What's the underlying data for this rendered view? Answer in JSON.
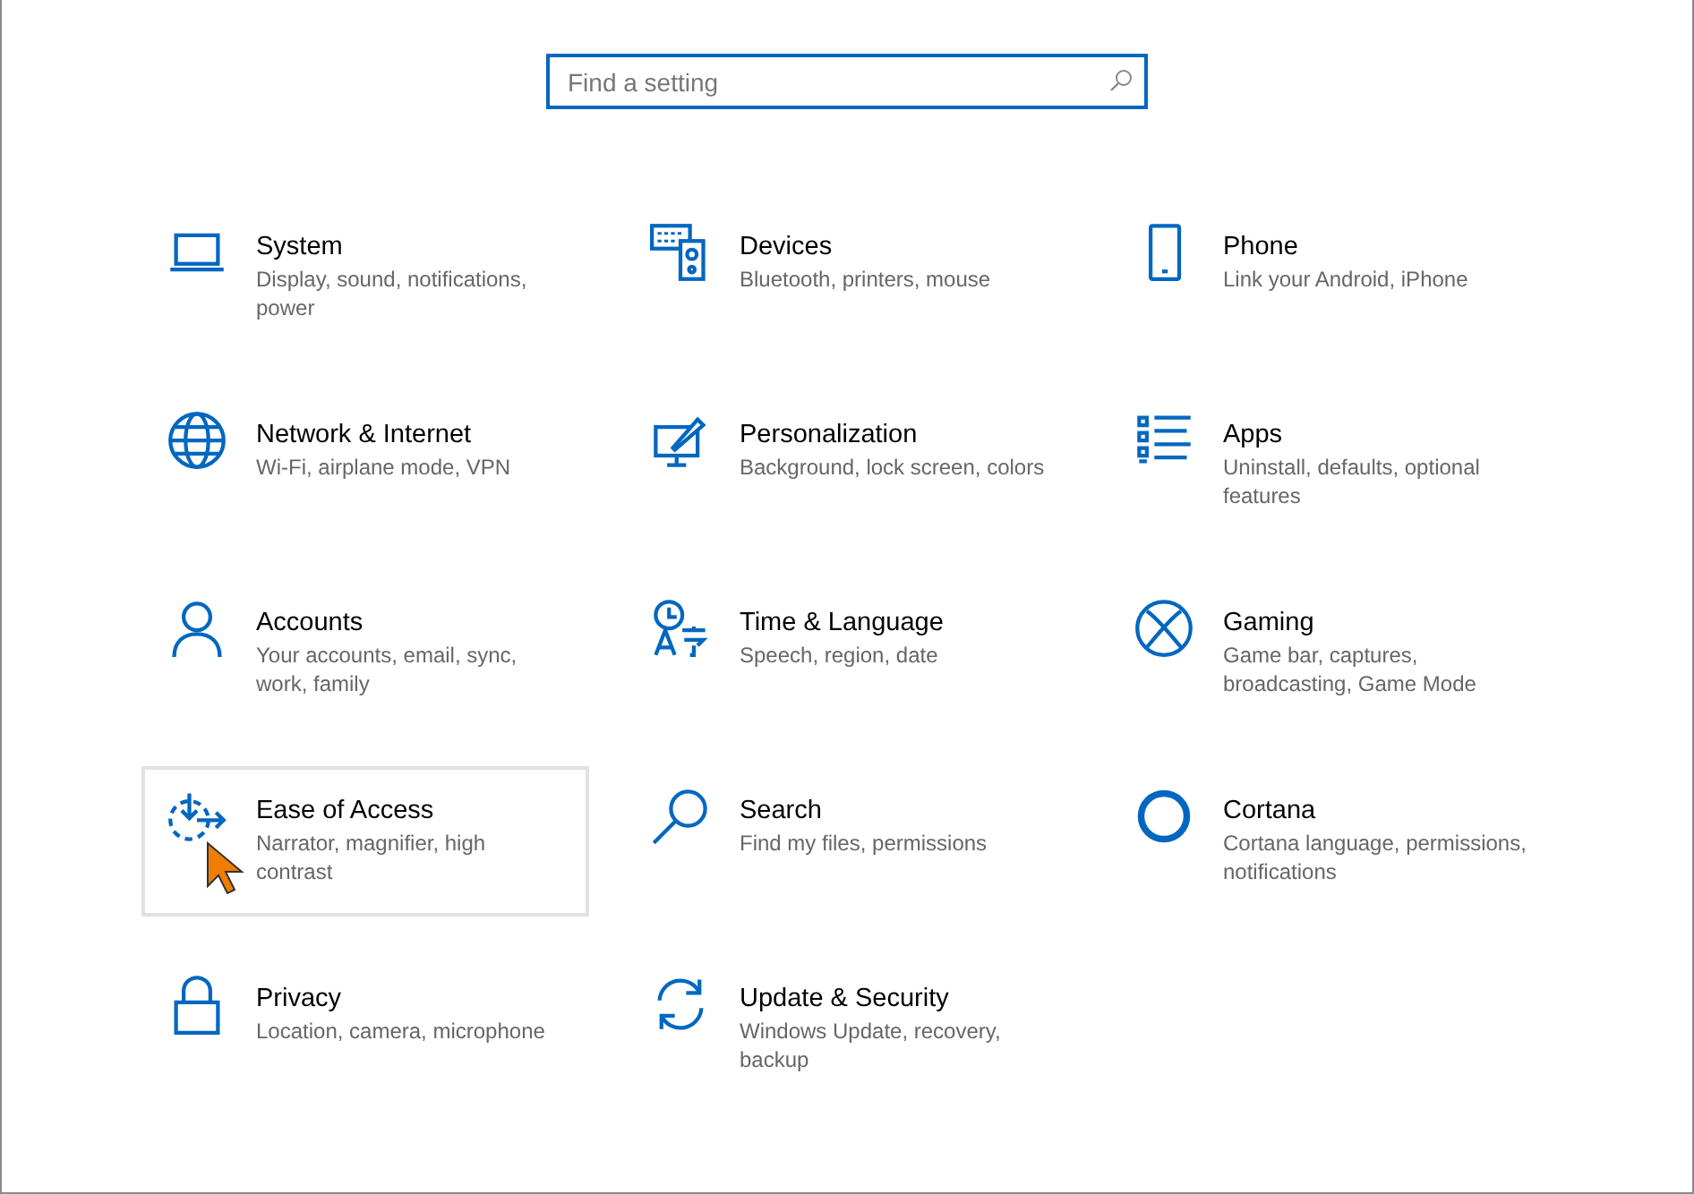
{
  "search": {
    "placeholder": "Find a setting"
  },
  "categories": [
    {
      "title": "System",
      "description": "Display, sound, notifications, power",
      "hovered": false
    },
    {
      "title": "Devices",
      "description": "Bluetooth, printers, mouse",
      "hovered": false
    },
    {
      "title": "Phone",
      "description": "Link your Android, iPhone",
      "hovered": false
    },
    {
      "title": "Network & Internet",
      "description": "Wi-Fi, airplane mode, VPN",
      "hovered": false
    },
    {
      "title": "Personalization",
      "description": "Background, lock screen, colors",
      "hovered": false
    },
    {
      "title": "Apps",
      "description": "Uninstall, defaults, optional features",
      "hovered": false
    },
    {
      "title": "Accounts",
      "description": "Your accounts, email, sync, work, family",
      "hovered": false
    },
    {
      "title": "Time & Language",
      "description": "Speech, region, date",
      "hovered": false
    },
    {
      "title": "Gaming",
      "description": "Game bar, captures, broadcasting, Game Mode",
      "hovered": false
    },
    {
      "title": "Ease of Access",
      "description": "Narrator, magnifier, high contrast",
      "hovered": true
    },
    {
      "title": "Search",
      "description": "Find my files, permissions",
      "hovered": false
    },
    {
      "title": "Cortana",
      "description": "Cortana language, permissions, notifications",
      "hovered": false
    },
    {
      "title": "Privacy",
      "description": "Location, camera, microphone",
      "hovered": false
    },
    {
      "title": "Update & Security",
      "description": "Windows Update, recovery, backup",
      "hovered": false
    }
  ]
}
